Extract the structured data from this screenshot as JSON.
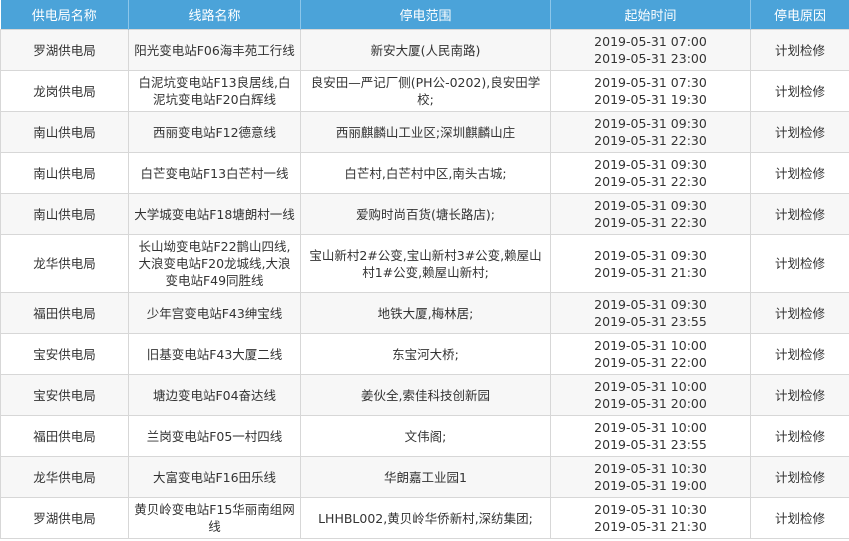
{
  "table": {
    "headers": [
      "供电局名称",
      "线路名称",
      "停电范围",
      "起始时间",
      "停电原因"
    ],
    "rows": [
      {
        "bureau": "罗湖供电局",
        "line": "阳光变电站F06海丰苑工行线",
        "scope": "新安大厦(人民南路)",
        "start": "2019-05-31 07:00",
        "end": "2019-05-31 23:00",
        "reason": "计划检修"
      },
      {
        "bureau": "龙岗供电局",
        "line": "白泥坑变电站F13良居线,白泥坑变电站F20白辉线",
        "scope": "良安田—严记厂侧(PH公-0202),良安田学校;",
        "start": "2019-05-31 07:30",
        "end": "2019-05-31 19:30",
        "reason": "计划检修"
      },
      {
        "bureau": "南山供电局",
        "line": "西丽变电站F12德意线",
        "scope": "西丽麒麟山工业区;深圳麒麟山庄",
        "start": "2019-05-31 09:30",
        "end": "2019-05-31 22:30",
        "reason": "计划检修"
      },
      {
        "bureau": "南山供电局",
        "line": "白芒变电站F13白芒村一线",
        "scope": "白芒村,白芒村中区,南头古城;",
        "start": "2019-05-31 09:30",
        "end": "2019-05-31 22:30",
        "reason": "计划检修"
      },
      {
        "bureau": "南山供电局",
        "line": "大学城变电站F18塘朗村一线",
        "scope": "爱购时尚百货(塘长路店);",
        "start": "2019-05-31 09:30",
        "end": "2019-05-31 22:30",
        "reason": "计划检修"
      },
      {
        "bureau": "龙华供电局",
        "line": "长山坳变电站F22鹊山四线,大浪变电站F20龙城线,大浪变电站F49同胜线",
        "scope": "宝山新村2#公变,宝山新村3#公变,赖屋山村1#公变,赖屋山新村;",
        "start": "2019-05-31 09:30",
        "end": "2019-05-31 21:30",
        "reason": "计划检修"
      },
      {
        "bureau": "福田供电局",
        "line": "少年宫变电站F43绅宝线",
        "scope": "地铁大厦,梅林居;",
        "start": "2019-05-31 09:30",
        "end": "2019-05-31 23:55",
        "reason": "计划检修"
      },
      {
        "bureau": "宝安供电局",
        "line": "旧基变电站F43大厦二线",
        "scope": "东宝河大桥;",
        "start": "2019-05-31 10:00",
        "end": "2019-05-31 22:00",
        "reason": "计划检修"
      },
      {
        "bureau": "宝安供电局",
        "line": "塘边变电站F04奋达线",
        "scope": "姜伙全,索佳科技创新园",
        "start": "2019-05-31 10:00",
        "end": "2019-05-31 20:00",
        "reason": "计划检修"
      },
      {
        "bureau": "福田供电局",
        "line": "兰岗变电站F05一村四线",
        "scope": "文伟阁;",
        "start": "2019-05-31 10:00",
        "end": "2019-05-31 23:55",
        "reason": "计划检修"
      },
      {
        "bureau": "龙华供电局",
        "line": "大富变电站F16田乐线",
        "scope": "华朗嘉工业园1",
        "start": "2019-05-31 10:30",
        "end": "2019-05-31 19:00",
        "reason": "计划检修"
      },
      {
        "bureau": "罗湖供电局",
        "line": "黄贝岭变电站F15华丽南组网线",
        "scope": "LHHBL002,黄贝岭华侨新村,深纺集团;",
        "start": "2019-05-31 10:30",
        "end": "2019-05-31 21:30",
        "reason": "计划检修"
      }
    ]
  }
}
